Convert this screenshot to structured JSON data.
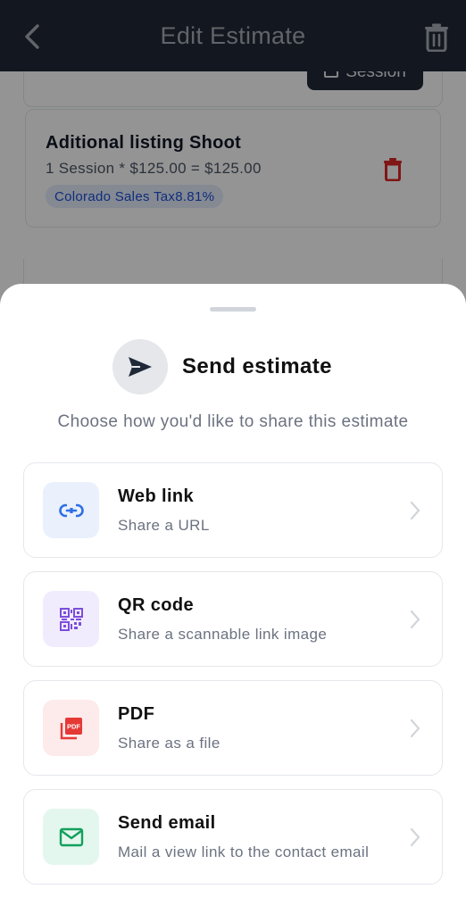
{
  "header": {
    "title": "Edit Estimate"
  },
  "background": {
    "session_button_label": "Session",
    "item": {
      "name": "Aditional listing Shoot",
      "calc": "1 Session * $125.00 = $125.00",
      "tax_badge": "Colorado Sales Tax8.81%"
    }
  },
  "sheet": {
    "title": "Send estimate",
    "subtitle": "Choose how you'd like to share this estimate",
    "options": [
      {
        "label": "Web link",
        "description": "Share a URL",
        "icon": "link-icon",
        "icon_bg": "#eaf1fd",
        "icon_color": "#2f6fe4"
      },
      {
        "label": "QR code",
        "description": "Share a scannable link image",
        "icon": "qr-code-icon",
        "icon_bg": "#f1ecfd",
        "icon_color": "#7c4ddb"
      },
      {
        "label": "PDF",
        "description": "Share as a file",
        "icon": "pdf-icon",
        "icon_bg": "#fdeaea",
        "icon_color": "#e53935"
      },
      {
        "label": "Send email",
        "description": "Mail a view link to the contact email",
        "icon": "mail-icon",
        "icon_bg": "#e4f7ee",
        "icon_color": "#12a05c"
      }
    ]
  },
  "colors": {
    "header_bg": "#1f2937",
    "delete_red": "#dc2626",
    "tax_badge_bg": "#e3ecfb"
  }
}
